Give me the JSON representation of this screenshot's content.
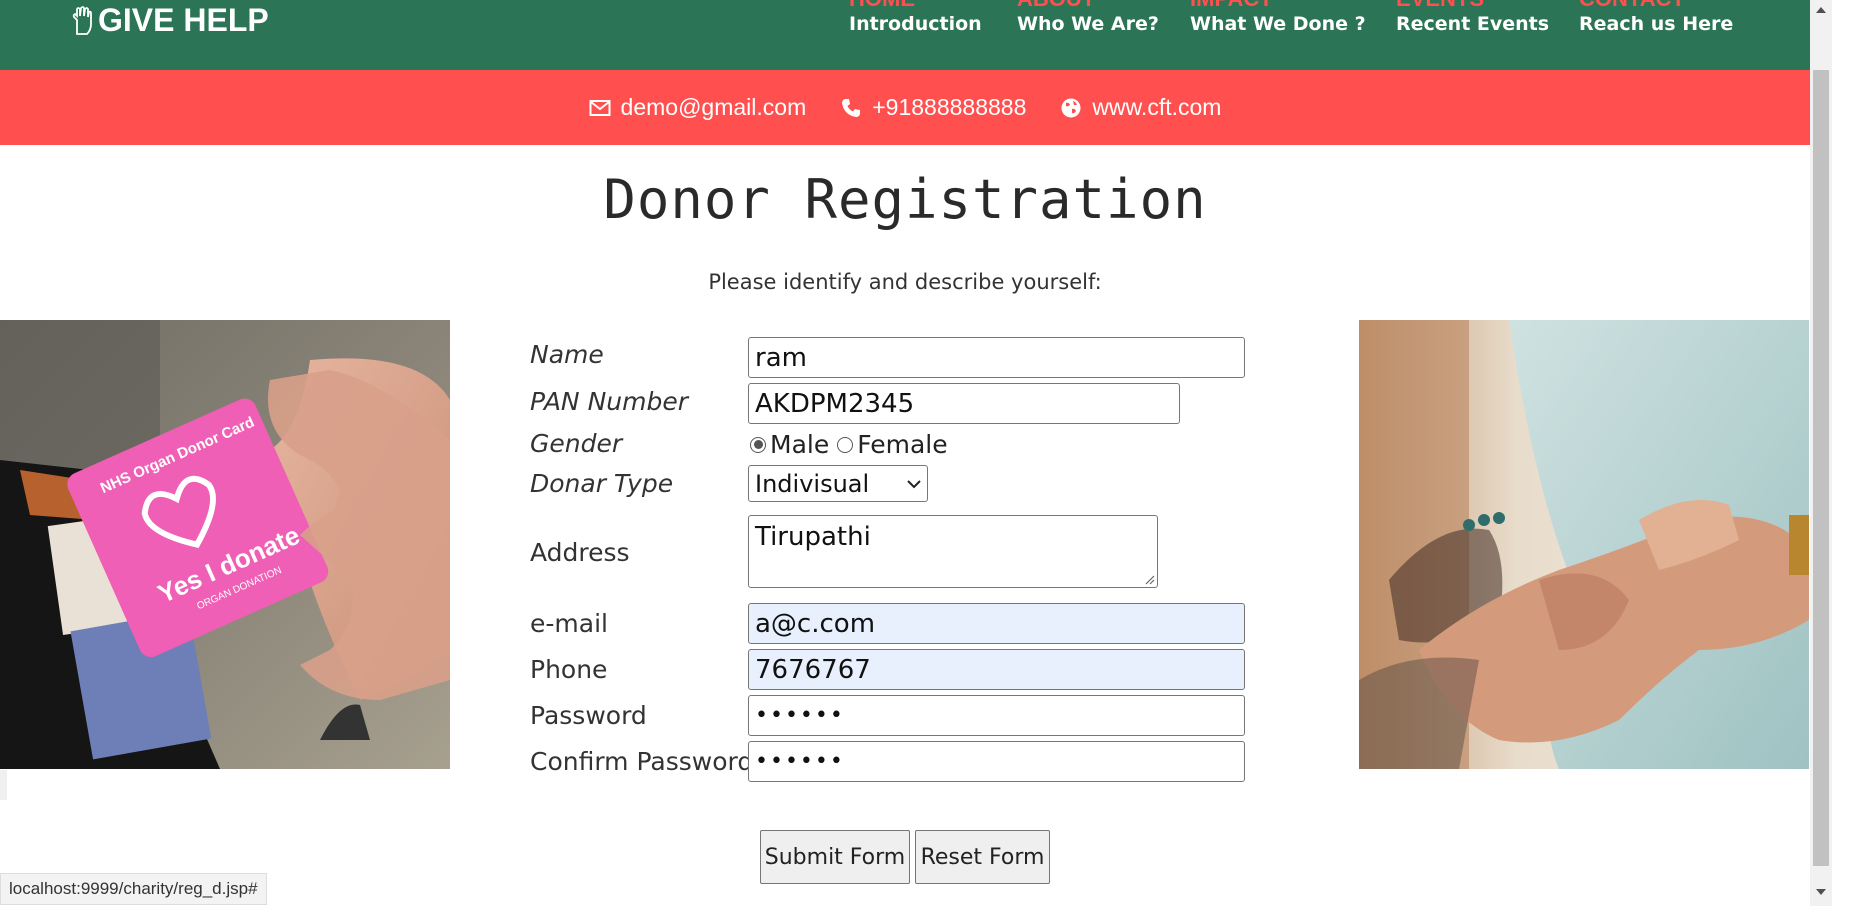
{
  "header": {
    "logo_text": "GIVE HELP",
    "nav": [
      {
        "top": "HOME",
        "bottom": "Introduction"
      },
      {
        "top": "ABOUT",
        "bottom": "Who We Are?"
      },
      {
        "top": "IMPACT",
        "bottom": "What We Done ?"
      },
      {
        "top": "EVENTS",
        "bottom": "Recent Events"
      },
      {
        "top": "CONTACT",
        "bottom": "Reach us Here"
      }
    ]
  },
  "contact": {
    "email": "demo@gmail.com",
    "phone": "+91888888888",
    "website": "www.cft.com"
  },
  "form": {
    "title": "Donor Registration",
    "subtitle": "Please identify and describe yourself:",
    "labels": {
      "name": "Name",
      "pan": "PAN Number",
      "gender": "Gender",
      "donor_type": "Donar Type",
      "address": "Address",
      "email": "e-mail",
      "phone": "Phone",
      "password": "Password",
      "confirm": "Confirm Password"
    },
    "values": {
      "name": "ram",
      "pan": "AKDPM2345",
      "donor_type": "Indivisual",
      "address": "Tirupathi",
      "email": "a@c.com",
      "phone": "7676767",
      "password": "••••••",
      "confirm": "••••••"
    },
    "gender_options": [
      "Male",
      "Female"
    ],
    "gender_selected": "Male",
    "submit_label": "Submit Form",
    "reset_label": "Reset Form"
  },
  "images": {
    "left_card_line1": "NHS Organ Donor Card",
    "left_card_line2": "Yes I donate",
    "left_card_line3": "ORGAN DONATION"
  },
  "status_url": "localhost:9999/charity/reg_d.jsp#",
  "colors": {
    "nav_bg": "#2b7456",
    "accent_red": "#ff4f4f",
    "autofill_bg": "#e8f0fe"
  }
}
